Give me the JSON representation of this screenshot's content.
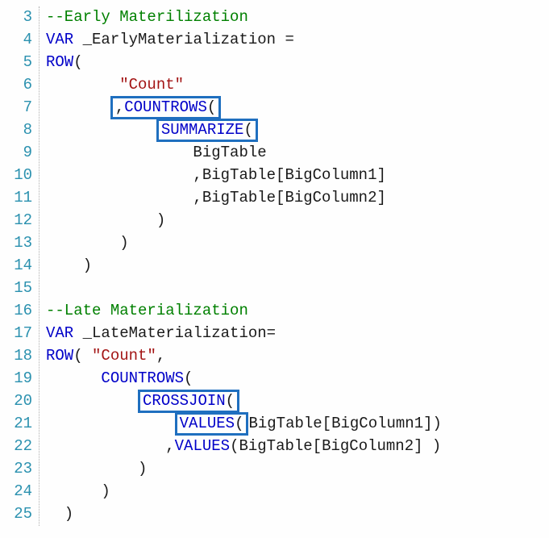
{
  "lines": [
    {
      "num": 3,
      "tokens": [
        {
          "t": "--Early Materilization",
          "c": "comment"
        }
      ]
    },
    {
      "num": 4,
      "tokens": [
        {
          "t": "VAR",
          "c": "keyword"
        },
        {
          "t": " _EarlyMaterialization ",
          "c": "ident"
        },
        {
          "t": "=",
          "c": "punct"
        }
      ]
    },
    {
      "num": 5,
      "tokens": [
        {
          "t": "ROW",
          "c": "keyword"
        },
        {
          "t": "(",
          "c": "punct"
        }
      ]
    },
    {
      "num": 6,
      "tokens": [
        {
          "t": "        ",
          "c": "punct"
        },
        {
          "t": "\"Count\"",
          "c": "string"
        }
      ]
    },
    {
      "num": 7,
      "tokens": [
        {
          "t": "       ",
          "c": "punct"
        },
        {
          "t": ",",
          "c": "punct",
          "box": true
        },
        {
          "t": "COUNTROWS",
          "c": "keyword",
          "box": true
        },
        {
          "t": "(",
          "c": "punct",
          "box": true
        }
      ],
      "boxgroup": true
    },
    {
      "num": 8,
      "tokens": [
        {
          "t": "            ",
          "c": "punct"
        },
        {
          "t": "SUMMARIZE",
          "c": "keyword",
          "box": true
        },
        {
          "t": "(",
          "c": "punct",
          "box": true
        }
      ],
      "boxgroup": true
    },
    {
      "num": 9,
      "tokens": [
        {
          "t": "                BigTable",
          "c": "ident"
        }
      ]
    },
    {
      "num": 10,
      "tokens": [
        {
          "t": "                ,BigTable[BigColumn1]",
          "c": "ident"
        }
      ]
    },
    {
      "num": 11,
      "tokens": [
        {
          "t": "                ,BigTable[BigColumn2]",
          "c": "ident"
        }
      ]
    },
    {
      "num": 12,
      "tokens": [
        {
          "t": "            )",
          "c": "punct"
        }
      ]
    },
    {
      "num": 13,
      "tokens": [
        {
          "t": "        )",
          "c": "punct"
        }
      ]
    },
    {
      "num": 14,
      "tokens": [
        {
          "t": "    )",
          "c": "punct"
        }
      ]
    },
    {
      "num": 15,
      "tokens": [
        {
          "t": "",
          "c": "punct"
        }
      ]
    },
    {
      "num": 16,
      "tokens": [
        {
          "t": "--Late Materialization",
          "c": "comment"
        }
      ]
    },
    {
      "num": 17,
      "tokens": [
        {
          "t": "VAR",
          "c": "keyword"
        },
        {
          "t": " _LateMaterialization",
          "c": "ident"
        },
        {
          "t": "=",
          "c": "punct"
        }
      ]
    },
    {
      "num": 18,
      "tokens": [
        {
          "t": "ROW",
          "c": "keyword"
        },
        {
          "t": "( ",
          "c": "punct"
        },
        {
          "t": "\"Count\"",
          "c": "string"
        },
        {
          "t": ",",
          "c": "punct"
        }
      ]
    },
    {
      "num": 19,
      "tokens": [
        {
          "t": "      ",
          "c": "punct"
        },
        {
          "t": "COUNTROWS",
          "c": "keyword"
        },
        {
          "t": "(",
          "c": "punct"
        }
      ]
    },
    {
      "num": 20,
      "tokens": [
        {
          "t": "          ",
          "c": "punct"
        },
        {
          "t": "CROSSJOIN",
          "c": "keyword",
          "box": true
        },
        {
          "t": "(",
          "c": "punct",
          "box": true
        }
      ],
      "boxgroup": true
    },
    {
      "num": 21,
      "tokens": [
        {
          "t": "              ",
          "c": "punct"
        },
        {
          "t": "VALUES",
          "c": "keyword",
          "box": true
        },
        {
          "t": "(",
          "c": "punct",
          "box": true
        },
        {
          "t": "BigTable[BigColumn1])",
          "c": "ident"
        }
      ],
      "boxgroup": true
    },
    {
      "num": 22,
      "tokens": [
        {
          "t": "             ,",
          "c": "punct"
        },
        {
          "t": "VALUES",
          "c": "keyword"
        },
        {
          "t": "(",
          "c": "punct"
        },
        {
          "t": "BigTable[BigColumn2] )",
          "c": "ident"
        }
      ]
    },
    {
      "num": 23,
      "tokens": [
        {
          "t": "          )",
          "c": "punct"
        }
      ]
    },
    {
      "num": 24,
      "tokens": [
        {
          "t": "      )",
          "c": "punct"
        }
      ]
    },
    {
      "num": 25,
      "tokens": [
        {
          "t": "  )",
          "c": "punct"
        }
      ]
    }
  ]
}
